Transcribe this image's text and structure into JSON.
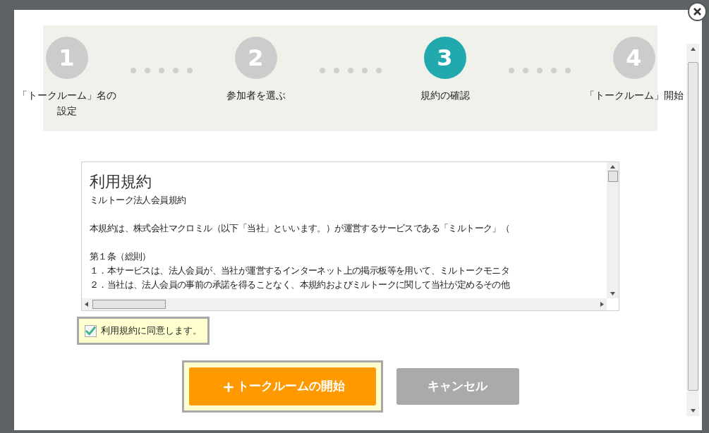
{
  "steps": [
    {
      "number": "1",
      "label": "「トークルーム」名の設定",
      "selected": false
    },
    {
      "number": "2",
      "label": "参加者を選ぶ",
      "selected": false
    },
    {
      "number": "3",
      "label": "規約の確認",
      "selected": true
    },
    {
      "number": "4",
      "label": "「トークルーム」開始",
      "selected": false
    }
  ],
  "terms": {
    "title": "利用規約",
    "paragraphs": [
      [
        "ミルトーク法人会員規約"
      ],
      [
        "本規約は、株式会社マクロミル（以下「当社」といいます。）が運営するサービスである「ミルトーク」（"
      ],
      [
        "第１条（総則）",
        "１．本サービスは、法人会員が、当社が運営するインターネット上の掲示板等を用いて、ミルトークモニタ",
        "２．当社は、法人会員の事前の承諾を得ることなく、本規約およびミルトークに関して当社が定めるその他"
      ]
    ]
  },
  "agree": {
    "label": "利用規約に同意します。",
    "checked": true
  },
  "buttons": [
    {
      "kind": "primary",
      "icon": "＋",
      "label": "トークルームの開始"
    },
    {
      "kind": "secondary",
      "label": "キャンセル"
    }
  ]
}
